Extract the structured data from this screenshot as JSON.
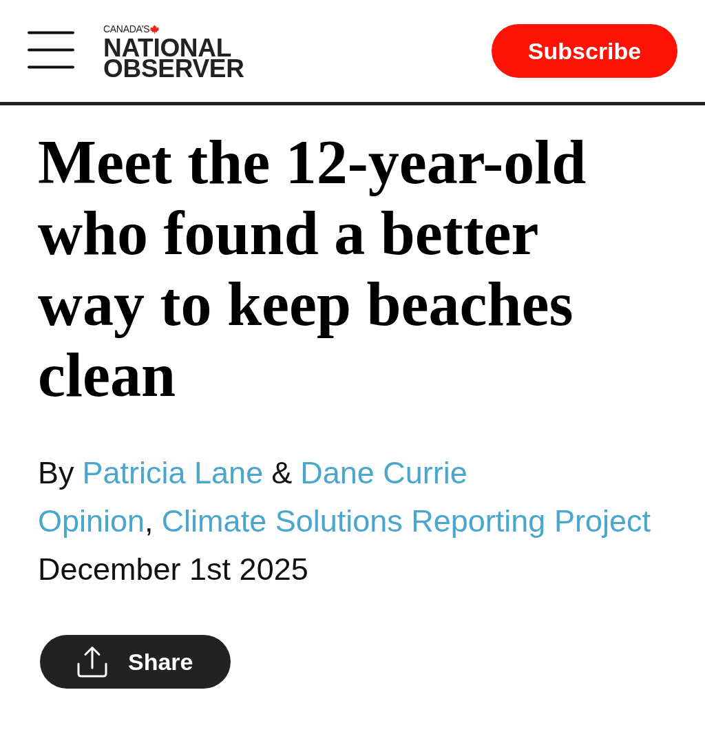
{
  "header": {
    "logo": {
      "tagline": "CANADA’S",
      "wordmark": [
        "NATIONAL",
        "OBSERVER"
      ]
    },
    "subscribe_button": "Subscribe"
  },
  "article": {
    "headline": "Meet the 12-year-old who found a better way to keep beaches clean",
    "byline": {
      "prefix": "By",
      "authors": [
        "Patricia Lane",
        "Dane Currie"
      ],
      "joiner": "&"
    },
    "sections": [
      "Opinion",
      "Climate Solutions Reporting Project"
    ],
    "section_separator": ",",
    "date": "December 1st 2025",
    "share_button": "Share"
  }
}
